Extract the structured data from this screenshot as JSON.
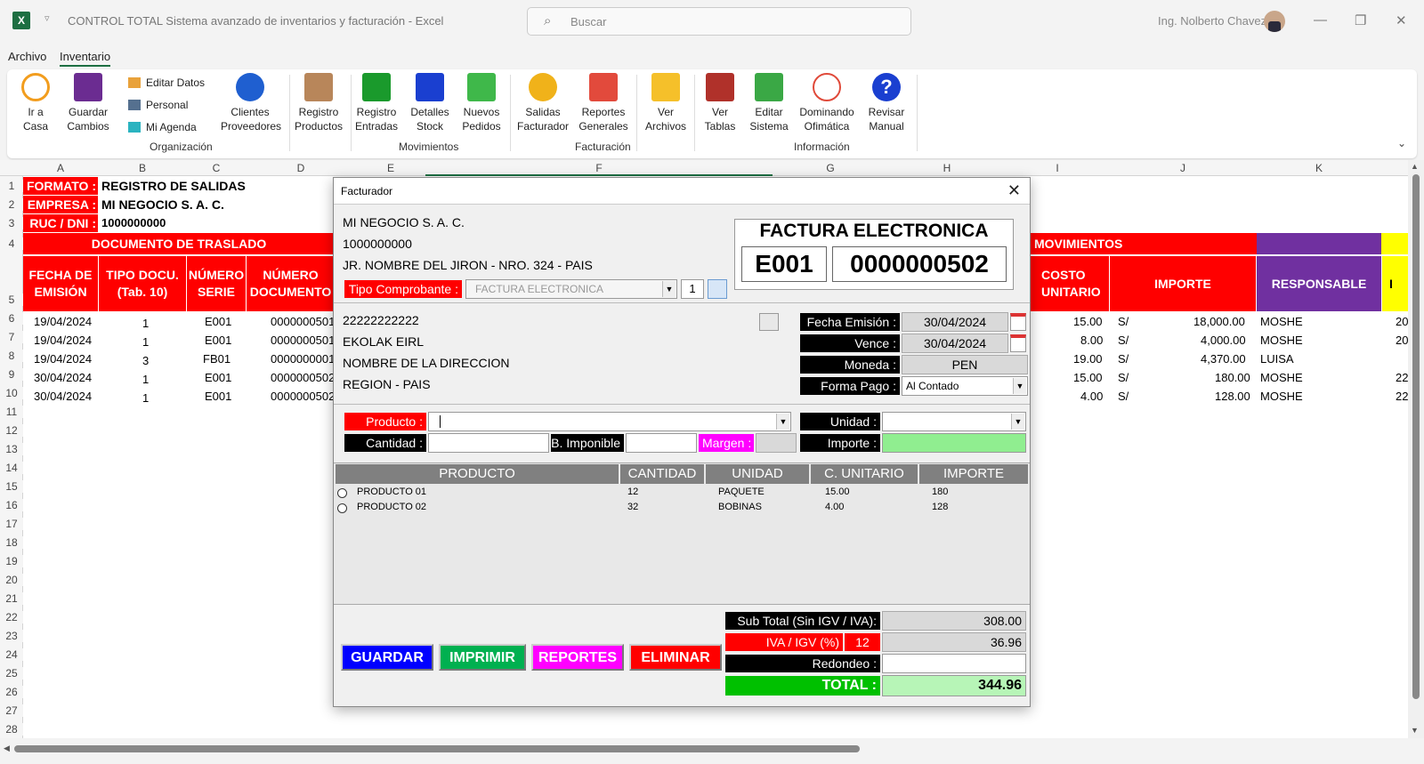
{
  "window": {
    "title": "CONTROL TOTAL Sistema avanzado de inventarios y facturación  -  Excel",
    "search_placeholder": "Buscar",
    "user": "Ing. Nolberto Chavez"
  },
  "menu": {
    "archivo": "Archivo",
    "inventario": "Inventario"
  },
  "ribbon": {
    "ir_a_casa": [
      "Ir a",
      "Casa"
    ],
    "guardar_cambios": [
      "Guardar",
      "Cambios"
    ],
    "editar_datos": "Editar Datos",
    "personal": "Personal",
    "mi_agenda": "Mi Agenda",
    "clientes": [
      "Clientes",
      "Proveedores"
    ],
    "registro_productos": [
      "Registro",
      "Productos"
    ],
    "registro_entradas": [
      "Registro",
      "Entradas"
    ],
    "detalles_stock": [
      "Detalles",
      "Stock"
    ],
    "nuevos_pedidos": [
      "Nuevos",
      "Pedidos"
    ],
    "salidas_facturador": [
      "Salidas",
      "Facturador"
    ],
    "reportes_generales": [
      "Reportes",
      "Generales"
    ],
    "ver_archivos": [
      "Ver",
      "Archivos"
    ],
    "ver_tablas": [
      "Ver",
      "Tablas"
    ],
    "editar_sistema": [
      "Editar",
      "Sistema"
    ],
    "dominando": [
      "Dominando",
      "Ofimática"
    ],
    "revisar_manual": [
      "Revisar",
      "Manual"
    ],
    "groups": {
      "organizacion": "Organización",
      "movimientos": "Movimientos",
      "facturacion": "Facturación",
      "informacion": "Información"
    }
  },
  "sheet": {
    "columns": [
      "A",
      "B",
      "C",
      "D",
      "E",
      "F",
      "G",
      "H",
      "I",
      "J",
      "K"
    ],
    "rows": [
      "1",
      "2",
      "3",
      "4",
      "5",
      "6",
      "7",
      "8",
      "9",
      "10",
      "11",
      "12",
      "13",
      "14",
      "15",
      "16",
      "17",
      "18",
      "19",
      "20",
      "21",
      "22",
      "23",
      "24",
      "25",
      "26",
      "27",
      "28"
    ],
    "formato_label": "FORMATO :",
    "formato_value": "REGISTRO DE SALIDAS",
    "empresa_label": "EMPRESA :",
    "empresa_value": "MI NEGOCIO S. A. C.",
    "ruc_label": "RUC / DNI :",
    "ruc_value": "1000000000",
    "doc_traslado": "DOCUMENTO DE TRASLADO",
    "movimientos": "MOVIMIENTOS",
    "h_fecha": [
      "FECHA DE",
      "EMISIÓN"
    ],
    "h_tipo": [
      "TIPO DOCU.",
      "(Tab. 10)"
    ],
    "h_serie": [
      "NÚMERO",
      "SERIE"
    ],
    "h_doc": [
      "NÚMERO",
      "DOCUMENTO"
    ],
    "h_costo": [
      "COSTO",
      "UNITARIO"
    ],
    "h_importe": "IMPORTE",
    "h_responsable": "RESPONSABLE",
    "h_more": "I",
    "data": [
      {
        "fecha": "19/04/2024",
        "tipo": "1",
        "serie": "E001",
        "doc": "0000000501",
        "costo": "15.00",
        "mon": "S/",
        "importe": "18,000.00",
        "resp": "MOSHE",
        "extra": "20"
      },
      {
        "fecha": "19/04/2024",
        "tipo": "1",
        "serie": "E001",
        "doc": "0000000501",
        "costo": "8.00",
        "mon": "S/",
        "importe": "4,000.00",
        "resp": "MOSHE",
        "extra": "20"
      },
      {
        "fecha": "19/04/2024",
        "tipo": "3",
        "serie": "FB01",
        "doc": "0000000001",
        "costo": "19.00",
        "mon": "S/",
        "importe": "4,370.00",
        "resp": "LUISA",
        "extra": ""
      },
      {
        "fecha": "30/04/2024",
        "tipo": "1",
        "serie": "E001",
        "doc": "0000000502",
        "costo": "15.00",
        "mon": "S/",
        "importe": "180.00",
        "resp": "MOSHE",
        "extra": "22"
      },
      {
        "fecha": "30/04/2024",
        "tipo": "1",
        "serie": "E001",
        "doc": "0000000502",
        "costo": "4.00",
        "mon": "S/",
        "importe": "128.00",
        "resp": "MOSHE",
        "extra": "22"
      }
    ]
  },
  "dialog": {
    "title": "Facturador",
    "company": "MI NEGOCIO S. A. C.",
    "ruc": "1000000000",
    "address": "JR. NOMBRE DEL JIRON - NRO. 324 - PAIS",
    "doc_type_heading": "FACTURA ELECTRONICA",
    "serie": "E001",
    "numero": "0000000502",
    "tipo_comprobante_label": "Tipo Comprobante :",
    "tipo_comprobante_value": "FACTURA ELECTRONICA",
    "tipo_num": "1",
    "client_ruc": "22222222222",
    "client_name": "EKOLAK EIRL",
    "client_address": "NOMBRE DE LA DIRECCION",
    "client_region": "REGION - PAIS",
    "fecha_emision_label": "Fecha Emisión :",
    "fecha_emision": "30/04/2024",
    "vence_label": "Vence :",
    "vence": "30/04/2024",
    "moneda_label": "Moneda :",
    "moneda": "PEN",
    "forma_pago_label": "Forma Pago :",
    "forma_pago": "Al Contado",
    "producto_label": "Producto :",
    "producto_value": "",
    "unidad_label": "Unidad :",
    "cantidad_label": "Cantidad :",
    "b_imponible_label": "B. Imponible",
    "margen_label": "Margen :",
    "importe_label": "Importe :",
    "table_headers": [
      "PRODUCTO",
      "CANTIDAD",
      "UNIDAD",
      "C. UNITARIO",
      "IMPORTE"
    ],
    "items": [
      {
        "producto": "PRODUCTO 01",
        "cantidad": "12",
        "unidad": "PAQUETE",
        "cu": "15.00",
        "importe": "180"
      },
      {
        "producto": "PRODUCTO 02",
        "cantidad": "32",
        "unidad": "BOBINAS",
        "cu": "4.00",
        "importe": "128"
      }
    ],
    "subtotal_label": "Sub Total (Sin IGV / IVA):",
    "subtotal": "308.00",
    "igv_label": "IVA / IGV (%)",
    "igv_rate": "12",
    "igv": "36.96",
    "redondeo_label": "Redondeo :",
    "redondeo": "",
    "total_label": "TOTAL :",
    "total": "344.96",
    "btn_guardar": "GUARDAR",
    "btn_imprimir": "IMPRIMIR",
    "btn_reportes": "REPORTES",
    "btn_eliminar": "ELIMINAR"
  }
}
